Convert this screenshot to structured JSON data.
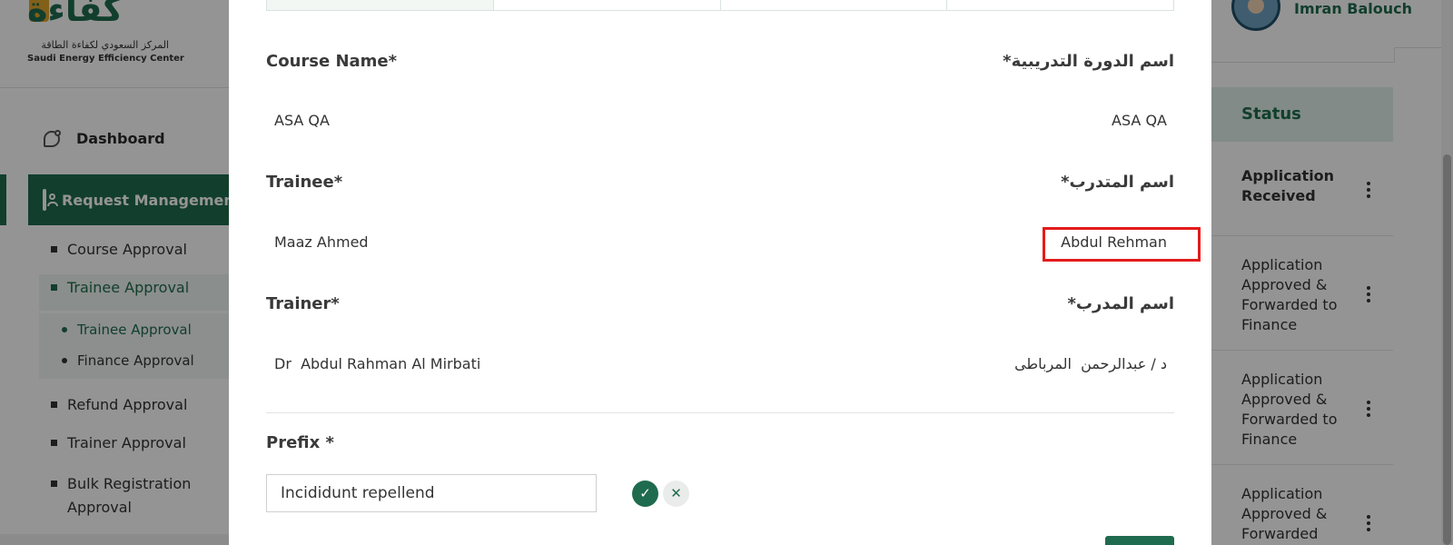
{
  "brand": {
    "logo_text": "كفاءة",
    "name_ar": "المركز السعودي لكفاءة الطاقة",
    "name_en": "Saudi Energy Efficiency Center"
  },
  "sidebar": {
    "dashboard": "Dashboard",
    "request_management": "Request Management",
    "items": [
      {
        "label": "Course Approval"
      },
      {
        "label": "Trainee Approval"
      },
      {
        "label": "Refund Approval"
      },
      {
        "label": "Trainer Approval"
      },
      {
        "label": "Bulk Registration Approval"
      }
    ],
    "subitems": [
      {
        "label": "Trainee Approval"
      },
      {
        "label": "Finance Approval"
      }
    ]
  },
  "user": {
    "name": "Imran Balouch"
  },
  "table": {
    "status_header": "Status",
    "rows": [
      {
        "status": "Application Received"
      },
      {
        "status": "Application Approved & Forwarded to Finance"
      },
      {
        "status": "Application Approved & Forwarded to Finance"
      },
      {
        "status": "Application Approved & Forwarded"
      }
    ]
  },
  "modal": {
    "course": {
      "label_en": "Course Name*",
      "label_ar": "اسم الدورة التدريبية*",
      "value_en": "ASA QA",
      "value_ar": "ASA QA"
    },
    "trainee": {
      "label_en": "Trainee*",
      "label_ar": "اسم المتدرب*",
      "value_en": "Maaz Ahmed",
      "value_ar": "Abdul Rehman"
    },
    "trainer": {
      "label_en": "Trainer*",
      "label_ar": "اسم المدرب*",
      "value_en": "Dr  Abdul Rahman Al Mirbati",
      "value_ar": "د / عبدالرحمن  المرباطى"
    },
    "prefix": {
      "label": "Prefix *",
      "value": "Incididunt repellend",
      "confirm_icon": "✓",
      "cancel_icon": "✕"
    }
  },
  "colors": {
    "brand_green": "#1f6b4f",
    "highlight_red": "#e31b1b"
  }
}
